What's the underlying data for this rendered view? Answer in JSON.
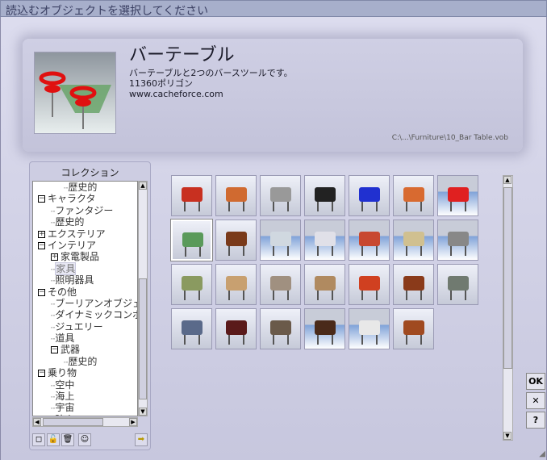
{
  "window": {
    "title": "読込むオブジェクトを選択してください"
  },
  "preview": {
    "title": "バーテーブル",
    "description": "バーテーブルと2つのバースツールです。",
    "polygons": "11360ポリゴン",
    "url": "www.cacheforce.com",
    "path": "C:\\...\\Furniture\\10_Bar Table.vob"
  },
  "collection": {
    "header": "コレクション",
    "items": [
      {
        "label": "歴史的",
        "level": 2,
        "toggle": ""
      },
      {
        "label": "キャラクタ",
        "level": 0,
        "toggle": "−"
      },
      {
        "label": "ファンタジー",
        "level": 1,
        "toggle": ""
      },
      {
        "label": "歴史的",
        "level": 1,
        "toggle": ""
      },
      {
        "label": "エクステリア",
        "level": 0,
        "toggle": "+"
      },
      {
        "label": "インテリア",
        "level": 0,
        "toggle": "−"
      },
      {
        "label": "家電製品",
        "level": 1,
        "toggle": "+"
      },
      {
        "label": "家具",
        "level": 1,
        "toggle": "",
        "selected": true
      },
      {
        "label": "照明器具",
        "level": 1,
        "toggle": ""
      },
      {
        "label": "その他",
        "level": 0,
        "toggle": "−"
      },
      {
        "label": "ブーリアンオブジェ",
        "level": 1,
        "toggle": ""
      },
      {
        "label": "ダイナミックコンポ",
        "level": 1,
        "toggle": ""
      },
      {
        "label": "ジュエリー",
        "level": 1,
        "toggle": ""
      },
      {
        "label": "道具",
        "level": 1,
        "toggle": ""
      },
      {
        "label": "武器",
        "level": 1,
        "toggle": "−"
      },
      {
        "label": "歴史的",
        "level": 2,
        "toggle": ""
      },
      {
        "label": "乗り物",
        "level": 0,
        "toggle": "−"
      },
      {
        "label": "空中",
        "level": 1,
        "toggle": ""
      },
      {
        "label": "海上",
        "level": 1,
        "toggle": ""
      },
      {
        "label": "宇宙",
        "level": 1,
        "toggle": ""
      },
      {
        "label": "陸上",
        "level": 1,
        "toggle": ""
      }
    ]
  },
  "thumbnails": [
    {
      "name": "red-armchair",
      "color": "#c83020",
      "floor": false
    },
    {
      "name": "orange-stool",
      "color": "#d06a30",
      "floor": false
    },
    {
      "name": "wire-chair",
      "color": "#999999",
      "floor": false
    },
    {
      "name": "checkered-chair",
      "color": "#222222",
      "floor": false
    },
    {
      "name": "blue-chair",
      "color": "#2030d0",
      "floor": false
    },
    {
      "name": "orange-sofa",
      "color": "#d86a30",
      "floor": false
    },
    {
      "name": "red-bar-stool",
      "color": "#e02020",
      "floor": true
    },
    {
      "name": "bar-table",
      "color": "#5a9a5a",
      "floor": false,
      "selected": true
    },
    {
      "name": "wooden-table",
      "color": "#7a3a1a",
      "floor": false
    },
    {
      "name": "round-glass-table",
      "color": "#d0d8e0",
      "floor": true
    },
    {
      "name": "glass-table",
      "color": "#e0e0e8",
      "floor": true
    },
    {
      "name": "round-red-table",
      "color": "#c84830",
      "floor": true
    },
    {
      "name": "glass-coffee-table",
      "color": "#d0c090",
      "floor": true
    },
    {
      "name": "metal-coffee-table",
      "color": "#888888",
      "floor": true
    },
    {
      "name": "plant-cart",
      "color": "#8a9a60",
      "floor": false
    },
    {
      "name": "bookshelf",
      "color": "#c8a070",
      "floor": false
    },
    {
      "name": "shelf-cabinet",
      "color": "#a09080",
      "floor": false
    },
    {
      "name": "wooden-shelf",
      "color": "#b08a60",
      "floor": false
    },
    {
      "name": "colorful-blocks",
      "color": "#d04020",
      "floor": false
    },
    {
      "name": "desk",
      "color": "#8a3a1a",
      "floor": false
    },
    {
      "name": "metal-cabinet",
      "color": "#707a70",
      "floor": false
    },
    {
      "name": "glass-cabinet",
      "color": "#5a6a8a",
      "floor": false
    },
    {
      "name": "dark-sideboard",
      "color": "#5a1a1a",
      "floor": false
    },
    {
      "name": "sideboard",
      "color": "#6a5a4a",
      "floor": false
    },
    {
      "name": "tv-stand",
      "color": "#4a2a1a",
      "floor": true
    },
    {
      "name": "white-dresser",
      "color": "#e8e8e8",
      "floor": true
    },
    {
      "name": "wooden-chest",
      "color": "#a04a20",
      "floor": false
    }
  ],
  "buttons": {
    "ok": "OK",
    "cancel": "✕",
    "help": "?"
  }
}
